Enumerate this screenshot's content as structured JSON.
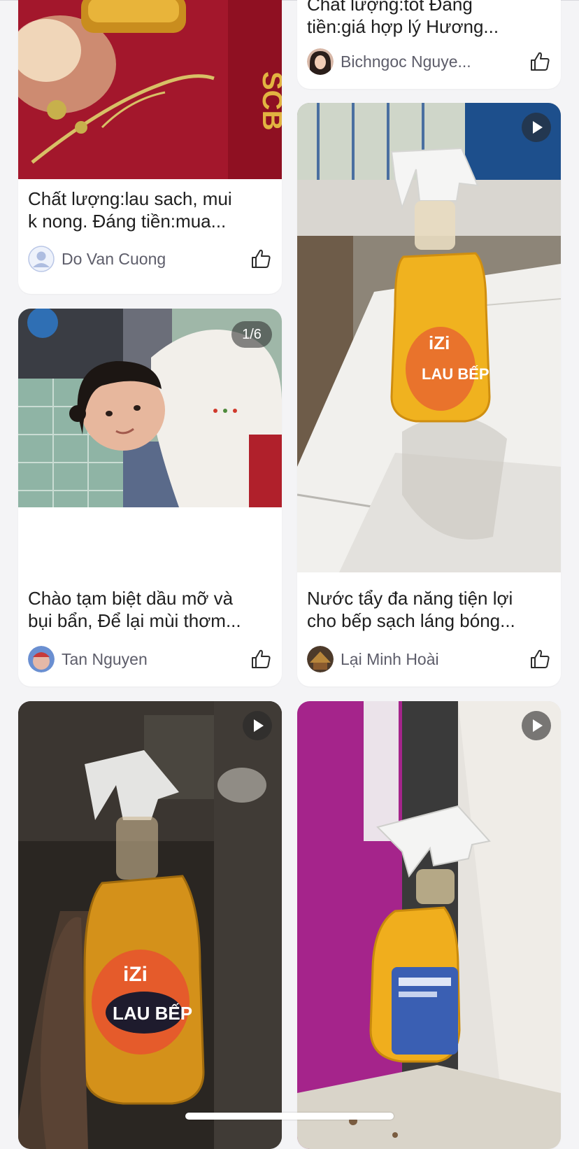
{
  "colors": {
    "background": "#f4f4f6",
    "card": "#ffffff",
    "caption_text": "#1e1e1e",
    "author_text": "#5d5d6a"
  },
  "posts": [
    {
      "caption": "Chất lượng:lau sach, mui\nk nong. Đáng tiền:mua...",
      "author": "Do Van Cuong",
      "avatar": "default-user-avatar",
      "media": "photo",
      "like_icon": "thumbs-up-icon"
    },
    {
      "caption": "Chất lượng:tốt Đáng\ntiền:giá hợp lý Hương...",
      "author": "Bichngoc Nguye...",
      "avatar": "user-photo-avatar",
      "media": "photo",
      "like_icon": "thumbs-up-icon"
    },
    {
      "caption": "Chào tạm biệt dầu mỡ và\nbụi bẩn, Để lại mùi thơm...",
      "author": "Tan Nguyen",
      "avatar": "user-photo-avatar",
      "media": "photo-gallery",
      "image_counter": "1/6",
      "like_icon": "thumbs-up-icon"
    },
    {
      "caption": "Nước tẩy đa năng tiện lợi\ncho bếp sạch láng bóng...",
      "author": "Lại Minh Hoài",
      "avatar": "user-photo-avatar",
      "media": "video",
      "like_icon": "thumbs-up-icon"
    },
    {
      "caption": "",
      "author": "",
      "media": "video"
    },
    {
      "caption": "",
      "author": "",
      "media": "video"
    }
  ]
}
